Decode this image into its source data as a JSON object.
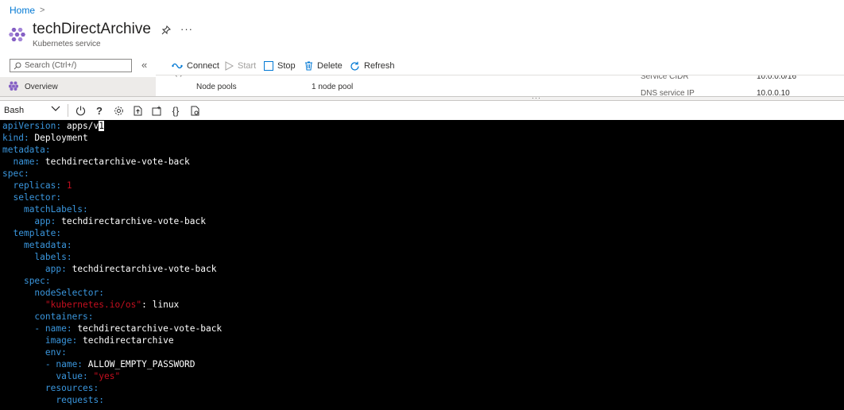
{
  "breadcrumb": {
    "home": "Home",
    "separator": ">"
  },
  "resource": {
    "title": "techDirectArchive",
    "subtitle": "Kubernetes service",
    "icon": "kubernetes-icon"
  },
  "search": {
    "placeholder": "Search (Ctrl+/)"
  },
  "commands": {
    "connect": "Connect",
    "start": "Start",
    "stop": "Stop",
    "delete": "Delete",
    "refresh": "Refresh"
  },
  "nav": {
    "overview": "Overview"
  },
  "essentials": {
    "node_pools_label": "Node pools",
    "node_pools_value": "1 node pool",
    "service_cidr_label": "Service CIDR",
    "service_cidr_value": "10.0.0.0/16",
    "dns_ip_label": "DNS service IP",
    "dns_ip_value": "10.0.0.10"
  },
  "shell": {
    "selected": "Bash"
  },
  "colors": {
    "accent": "#0078d4",
    "yaml_key": "#3a96dd",
    "yaml_number": "#c50f1f",
    "terminal_bg": "#000000"
  },
  "terminal": {
    "lines": [
      {
        "indent": "",
        "key": "apiVersion:",
        "value": " apps/v",
        "cursor": "1",
        "vclass": "v"
      },
      {
        "indent": "",
        "key": "kind:",
        "value": " Deployment",
        "vclass": "v"
      },
      {
        "indent": "",
        "key": "metadata:",
        "value": "",
        "vclass": "v"
      },
      {
        "indent": "  ",
        "key": "name:",
        "value": " techdirectarchive-vote-back",
        "vclass": "v"
      },
      {
        "indent": "",
        "key": "spec:",
        "value": "",
        "vclass": "v"
      },
      {
        "indent": "  ",
        "key": "replicas:",
        "value": " 1",
        "vclass": "r"
      },
      {
        "indent": "  ",
        "key": "selector:",
        "value": "",
        "vclass": "v"
      },
      {
        "indent": "    ",
        "key": "matchLabels:",
        "value": "",
        "vclass": "v"
      },
      {
        "indent": "      ",
        "key": "app:",
        "value": " techdirectarchive-vote-back",
        "vclass": "v"
      },
      {
        "indent": "  ",
        "key": "template:",
        "value": "",
        "vclass": "v"
      },
      {
        "indent": "    ",
        "key": "metadata:",
        "value": "",
        "vclass": "v"
      },
      {
        "indent": "      ",
        "key": "labels:",
        "value": "",
        "vclass": "v"
      },
      {
        "indent": "        ",
        "key": "app:",
        "value": " techdirectarchive-vote-back",
        "vclass": "v"
      },
      {
        "indent": "    ",
        "key": "spec:",
        "value": "",
        "vclass": "v"
      },
      {
        "indent": "      ",
        "key": "nodeSelector:",
        "value": "",
        "vclass": "v"
      },
      {
        "indent": "        ",
        "key": "\"kubernetes.io/os\"",
        "kclass": "r",
        "value": ": linux",
        "vclass": "v"
      },
      {
        "indent": "      ",
        "key": "containers:",
        "value": "",
        "vclass": "v"
      },
      {
        "indent": "      ",
        "key": "- name:",
        "value": " techdirectarchive-vote-back",
        "vclass": "v"
      },
      {
        "indent": "        ",
        "key": "image:",
        "value": " techdirectarchive",
        "vclass": "v"
      },
      {
        "indent": "        ",
        "key": "env:",
        "value": "",
        "vclass": "v"
      },
      {
        "indent": "        ",
        "key": "- name:",
        "value": " ALLOW_EMPTY_PASSWORD",
        "vclass": "v"
      },
      {
        "indent": "          ",
        "key": "value:",
        "value": " \"yes\"",
        "vclass": "r"
      },
      {
        "indent": "        ",
        "key": "resources:",
        "value": "",
        "vclass": "v"
      },
      {
        "indent": "          ",
        "key": "requests:",
        "value": "",
        "vclass": "v"
      }
    ]
  }
}
